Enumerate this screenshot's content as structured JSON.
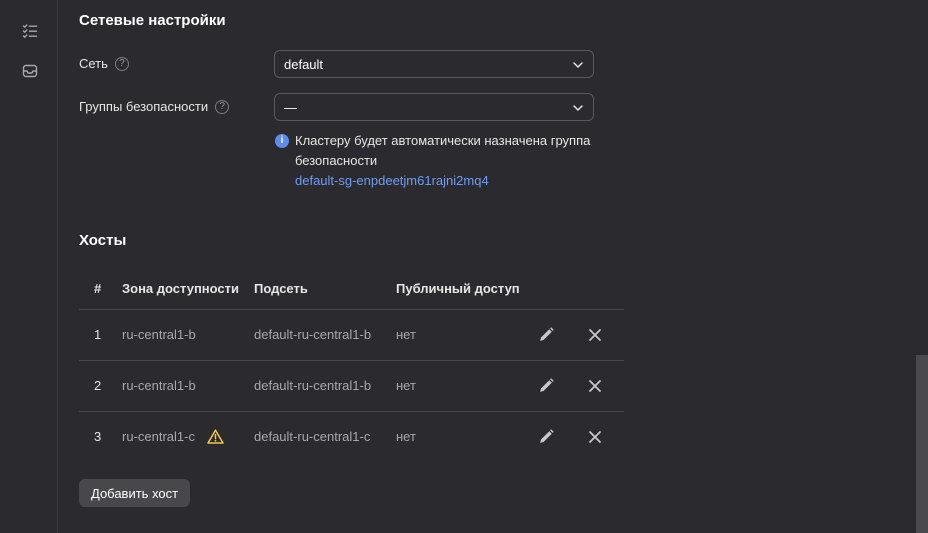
{
  "rail": {
    "icons": [
      "checklist-icon",
      "inbox-icon"
    ]
  },
  "network_section": {
    "title": "Сетевые настройки",
    "network_label": "Сеть",
    "network_value": "default",
    "security_groups_label": "Группы безопасности",
    "security_groups_value": "—",
    "info_text": "Кластеру будет автоматически назначена группа безопасности",
    "info_link": "default-sg-enpdeetjm61rajni2mq4",
    "help_glyph": "?"
  },
  "hosts_section": {
    "title": "Хосты",
    "columns": [
      "#",
      "Зона доступности",
      "Подсеть",
      "Публичный доступ"
    ],
    "rows": [
      {
        "num": "1",
        "zone": "ru-central1-b",
        "subnet": "default-ru-central1-b",
        "public": "нет",
        "warning": false
      },
      {
        "num": "2",
        "zone": "ru-central1-b",
        "subnet": "default-ru-central1-b",
        "public": "нет",
        "warning": false
      },
      {
        "num": "3",
        "zone": "ru-central1-c",
        "subnet": "default-ru-central1-c",
        "public": "нет",
        "warning": true
      }
    ],
    "add_button": "Добавить хост"
  },
  "colors": {
    "background": "#2b2a2e",
    "link": "#6e9df5",
    "info": "#5b8def",
    "warning": "#f5c843"
  }
}
